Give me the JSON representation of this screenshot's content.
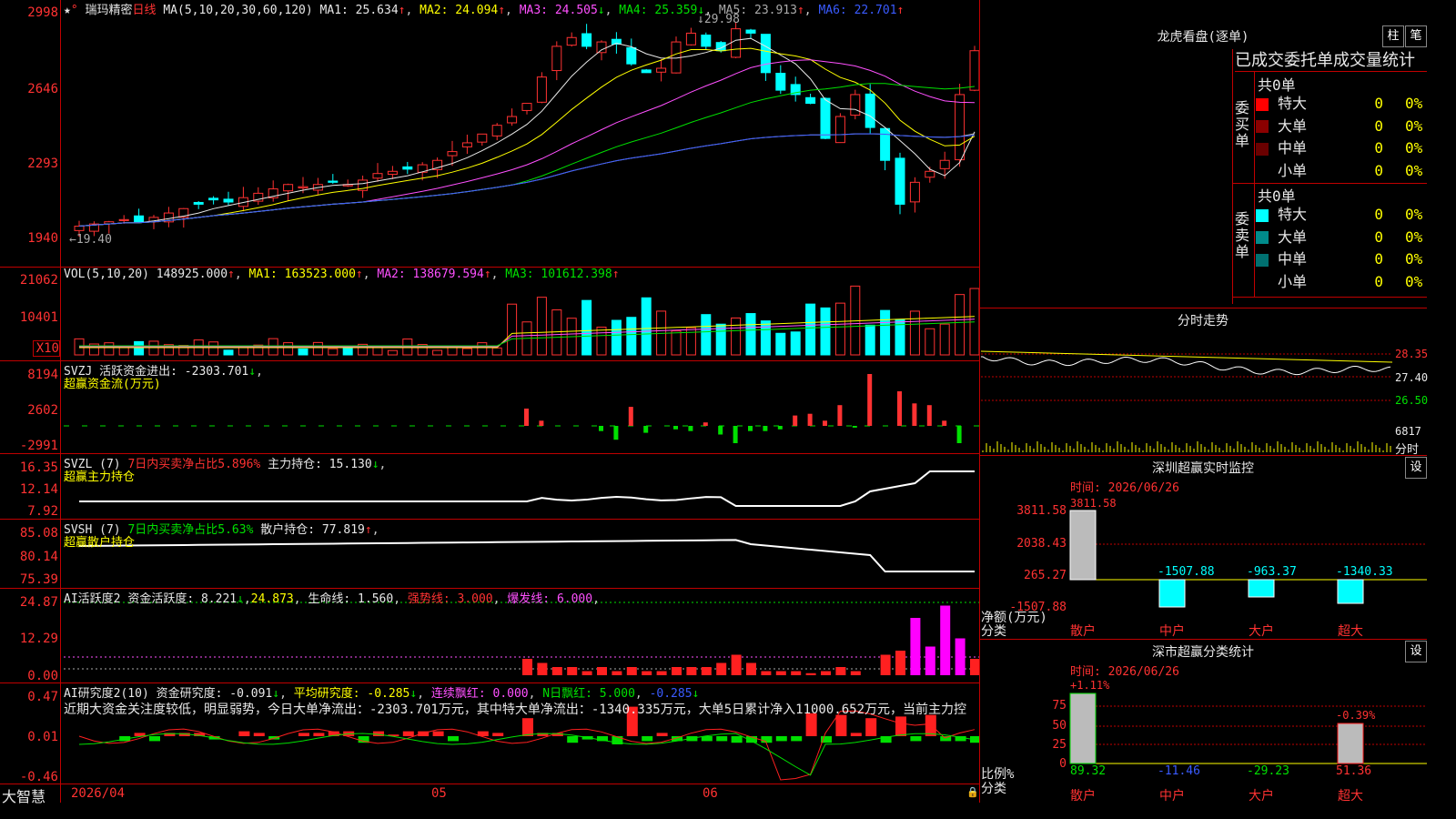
{
  "header": {
    "stock_name": "瑞玛精密",
    "period": "日线",
    "ma_label": "MA(5,10,20,30,60,120)",
    "ma1": "MA1: 25.634",
    "ma2": "MA2: 24.094",
    "ma3": "MA3: 24.505",
    "ma4": "MA4: 25.359",
    "ma5": "MA5: 23.913",
    "ma6": "MA6: 22.701",
    "high_label": "29.98",
    "low_label": "←19.40"
  },
  "price_axis": [
    "2998",
    "2646",
    "2293",
    "1940"
  ],
  "vol": {
    "title": "VOL(5,10,20)",
    "value": "148925.000",
    "ma1": "MA1: 163523.000",
    "ma2": "MA2: 138679.594",
    "ma3": "MA3: 101612.398",
    "axis": [
      "21062",
      "10401",
      "X10"
    ]
  },
  "svzj": {
    "title": "SVZJ",
    "text": "活跃资金进出: -2303.701",
    "sub": "超赢资金流(万元)",
    "axis": [
      "8194",
      "2602",
      "-2991"
    ]
  },
  "svzl": {
    "title": "SVZL (7)",
    "ratio": "7日内买卖净占比5.896%",
    "text": "主力持仓: 15.130",
    "sub": "超赢主力持仓",
    "axis": [
      "16.35",
      "12.14",
      "7.92"
    ]
  },
  "svsh": {
    "title": "SVSH (7)",
    "ratio": "7日内买卖净占比5.63%",
    "text": "散户持仓: 77.819",
    "sub": "超赢散户持仓",
    "axis": [
      "85.08",
      "80.14",
      "75.39"
    ]
  },
  "ai_act": {
    "title": "AI活跃度2",
    "text": "资金活跃度: 8.221",
    "v2": "24.873",
    "life": "生命线: 1.560",
    "strong": "强势线: 3.000",
    "burst": "爆发线: 6.000",
    "axis": [
      "24.87",
      "12.29",
      "0.00"
    ]
  },
  "ai_res": {
    "title": "AI研究度2(10)",
    "text": "资金研究度: -0.091",
    "avg": "平均研究度: -0.285",
    "red": "连续飘红: 0.000",
    "nred": "N日飘红: 5.000",
    "last": "-0.285",
    "comment": "近期大资金关注度较低，明显弱势，今日大单净流出：-2303.701万元，其中特大单净流出：-1340.335万元，大单5日累计净入11000.652万元，当前主力控",
    "axis": [
      "0.47",
      "0.01",
      "-0.46"
    ]
  },
  "footer": {
    "brand": "大智慧",
    "date": "2026/04",
    "m5": "05",
    "m6": "06"
  },
  "right": {
    "lhb_title": "龙虎看盘(逐单)",
    "btn_bar": "柱",
    "btn_pen": "笔",
    "ob_title": "已成交委托单成交量统计",
    "buy_label": "委买单",
    "sell_label": "委卖单",
    "buy_total": "共0单",
    "sell_total": "共0单",
    "buy_rows": [
      {
        "label": "特大",
        "n": "0",
        "p": "0%",
        "color": "#ff0000"
      },
      {
        "label": "大单",
        "n": "0",
        "p": "0%",
        "color": "#8b0000"
      },
      {
        "label": "中单",
        "n": "0",
        "p": "0%",
        "color": "#6a0000"
      },
      {
        "label": "小单",
        "n": "0",
        "p": "0%",
        "color": ""
      }
    ],
    "sell_rows": [
      {
        "label": "特大",
        "n": "0",
        "p": "0%",
        "color": "#00ffff"
      },
      {
        "label": "大单",
        "n": "0",
        "p": "0%",
        "color": "#008b8b"
      },
      {
        "label": "中单",
        "n": "0",
        "p": "0%",
        "color": "#007070"
      },
      {
        "label": "小单",
        "n": "0",
        "p": "0%",
        "color": ""
      }
    ],
    "fs_title": "分时走势",
    "fs_axis": [
      "28.35",
      "27.40",
      "26.50",
      "6817",
      "分时"
    ],
    "sz_title": "深圳超赢实时监控",
    "sz_btn": "设",
    "sz_time": "时间: 2026/06/26",
    "sz_axis": [
      "3811.58",
      "2038.43",
      "265.27",
      "-1507.88"
    ],
    "sz_unit": "净额(万元)",
    "sz_cat": "分类",
    "sz_values": [
      "3811.58",
      "-1507.88",
      "-963.37",
      "-1340.33"
    ],
    "sz_cats": [
      "散户",
      "中户",
      "大户",
      "超大"
    ],
    "sc_title": "深市超赢分类统计",
    "sc_btn": "设",
    "sc_time": "时间: 2026/06/26",
    "sc_top": [
      "+1.11%",
      "-0.39%"
    ],
    "sc_axis": [
      "75",
      "50",
      "25",
      "0"
    ],
    "sc_unit": "比例%",
    "sc_cat": "分类",
    "sc_values": [
      "89.32",
      "-11.46",
      "-29.23",
      "51.36"
    ],
    "sc_cats": [
      "散户",
      "中户",
      "大户",
      "超大"
    ]
  },
  "colors": {
    "up": "#ff3232",
    "down": "#00ffff",
    "grid": "#c00000"
  }
}
